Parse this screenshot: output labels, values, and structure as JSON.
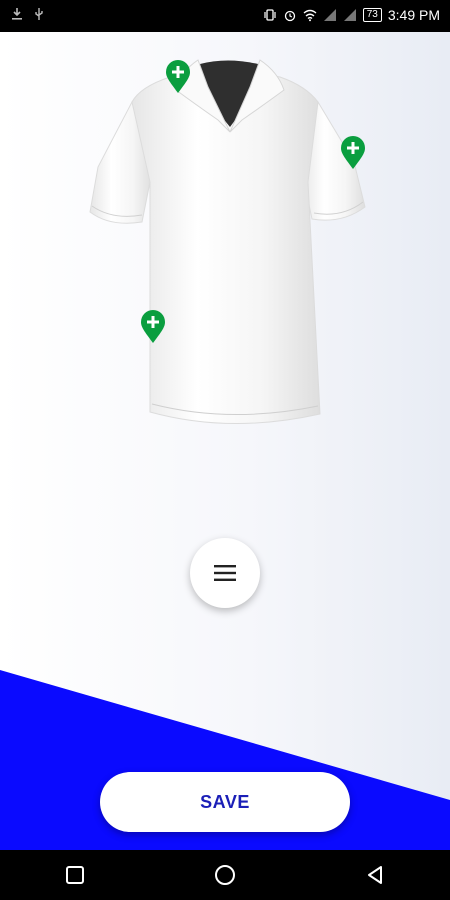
{
  "status_bar": {
    "time": "3:49 PM",
    "battery": "73",
    "icons": [
      "download-icon",
      "usb-icon",
      "vibrate-icon",
      "alarm-icon",
      "wifi-icon",
      "signal-icon",
      "signal-icon-2",
      "battery-icon"
    ]
  },
  "editor": {
    "product": "polo-shirt",
    "add_pins": [
      "collar-left",
      "right-sleeve",
      "left-hip"
    ],
    "accent_color": "#0a9e3f"
  },
  "actions": {
    "menu_icon": "hamburger-menu-icon",
    "save_label": "SAVE"
  },
  "theme": {
    "wedge_color": "#0a0aff",
    "save_text_color": "#1b1fb7"
  },
  "nav_bar": {
    "buttons": [
      "recents-square-icon",
      "home-circle-icon",
      "back-triangle-icon"
    ]
  }
}
